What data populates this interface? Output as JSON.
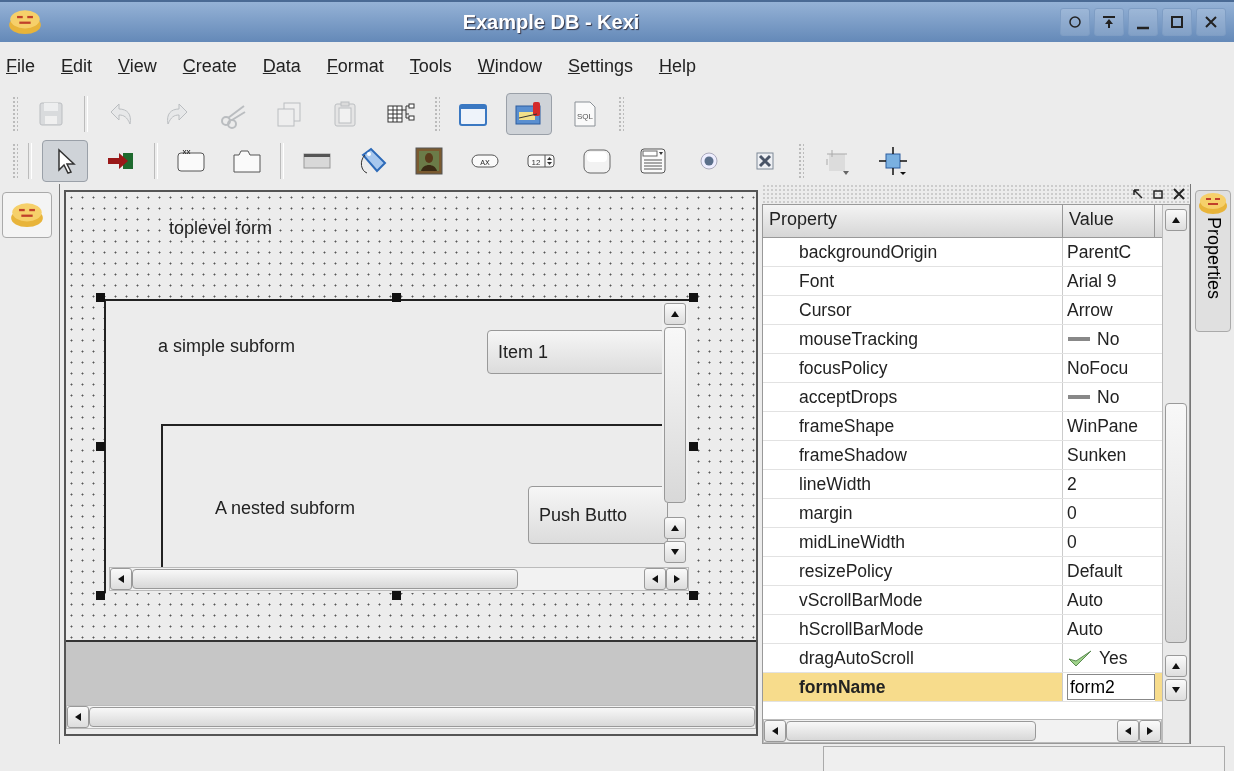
{
  "window": {
    "title": "Example DB - Kexi",
    "buttons": [
      {
        "kind": "circle"
      },
      {
        "kind": "shade"
      },
      {
        "kind": "minimize"
      },
      {
        "kind": "maximize"
      },
      {
        "kind": "close"
      }
    ]
  },
  "menu": [
    "File",
    "Edit",
    "View",
    "Create",
    "Data",
    "Format",
    "Tools",
    "Window",
    "Settings",
    "Help"
  ],
  "toolbars": [
    [
      {
        "kind": "grip"
      },
      {
        "kind": "save",
        "disabled": true,
        "selected": false
      },
      {
        "kind": "separator"
      },
      {
        "kind": "undo",
        "disabled": true,
        "selected": false
      },
      {
        "kind": "redo",
        "disabled": true,
        "selected": false
      },
      {
        "kind": "cut",
        "disabled": true,
        "selected": false
      },
      {
        "kind": "copy",
        "disabled": true,
        "selected": false
      },
      {
        "kind": "paste",
        "disabled": true,
        "selected": false
      },
      {
        "kind": "relations",
        "disabled": false,
        "selected": false
      },
      {
        "kind": "grip"
      },
      {
        "kind": "window",
        "disabled": false,
        "selected": false
      },
      {
        "kind": "design",
        "disabled": false,
        "selected": true
      },
      {
        "kind": "sql",
        "text": "SQL",
        "disabled": false,
        "selected": false
      },
      {
        "kind": "grip"
      }
    ],
    [
      {
        "kind": "grip"
      },
      {
        "kind": "separator"
      },
      {
        "kind": "pointer",
        "disabled": false,
        "selected": true
      },
      {
        "kind": "redirect",
        "disabled": false,
        "selected": false
      },
      {
        "kind": "separator"
      },
      {
        "kind": "frame",
        "disabled": false,
        "selected": false
      },
      {
        "kind": "tabs",
        "disabled": false,
        "selected": false
      },
      {
        "kind": "separator"
      },
      {
        "kind": "lineedit",
        "disabled": false,
        "selected": false
      },
      {
        "kind": "tag",
        "disabled": false,
        "selected": false
      },
      {
        "kind": "image",
        "disabled": false,
        "selected": false
      },
      {
        "kind": "textlabel",
        "text": "AX",
        "disabled": false,
        "selected": false
      },
      {
        "kind": "spin",
        "text": "12",
        "disabled": false,
        "selected": false
      },
      {
        "kind": "pushbutton",
        "disabled": false,
        "selected": false
      },
      {
        "kind": "listbox",
        "disabled": false,
        "selected": false
      },
      {
        "kind": "radio",
        "disabled": false,
        "selected": false
      },
      {
        "kind": "checkbox",
        "disabled": false,
        "selected": false
      },
      {
        "kind": "grip"
      },
      {
        "kind": "layout",
        "disabled": false,
        "selected": false
      },
      {
        "kind": "adjust",
        "disabled": false,
        "selected": false
      }
    ]
  ],
  "form": {
    "label": "toplevel form",
    "subform": {
      "label": "a simple subform",
      "button": "Item 1",
      "nested": {
        "label": "A nested subform",
        "button": "Push Butto"
      }
    }
  },
  "properties": {
    "tab": "Properties",
    "columns": [
      "Property",
      "Value"
    ],
    "rows": [
      {
        "name": "backgroundOrigin",
        "value": "ParentC",
        "kind": "text",
        "selected": false
      },
      {
        "name": "Font",
        "value": "Arial 9",
        "kind": "text",
        "selected": false
      },
      {
        "name": "Cursor",
        "value": "Arrow",
        "kind": "text",
        "selected": false
      },
      {
        "name": "mouseTracking",
        "value": "No",
        "kind": "bool",
        "on": false,
        "selected": false
      },
      {
        "name": "focusPolicy",
        "value": "NoFocu",
        "kind": "text",
        "selected": false
      },
      {
        "name": "acceptDrops",
        "value": "No",
        "kind": "bool",
        "on": false,
        "selected": false
      },
      {
        "name": "frameShape",
        "value": "WinPane",
        "kind": "text",
        "selected": false
      },
      {
        "name": "frameShadow",
        "value": "Sunken",
        "kind": "text",
        "selected": false
      },
      {
        "name": "lineWidth",
        "value": "2",
        "kind": "text",
        "selected": false
      },
      {
        "name": "margin",
        "value": "0",
        "kind": "text",
        "selected": false
      },
      {
        "name": "midLineWidth",
        "value": "0",
        "kind": "text",
        "selected": false
      },
      {
        "name": "resizePolicy",
        "value": "Default",
        "kind": "text",
        "selected": false
      },
      {
        "name": "vScrollBarMode",
        "value": "Auto",
        "kind": "text",
        "selected": false
      },
      {
        "name": "hScrollBarMode",
        "value": "Auto",
        "kind": "text",
        "selected": false
      },
      {
        "name": "dragAutoScroll",
        "value": "Yes",
        "kind": "bool",
        "on": true,
        "selected": false
      },
      {
        "name": "formName",
        "value": "form2",
        "kind": "text",
        "selected": true
      }
    ]
  }
}
